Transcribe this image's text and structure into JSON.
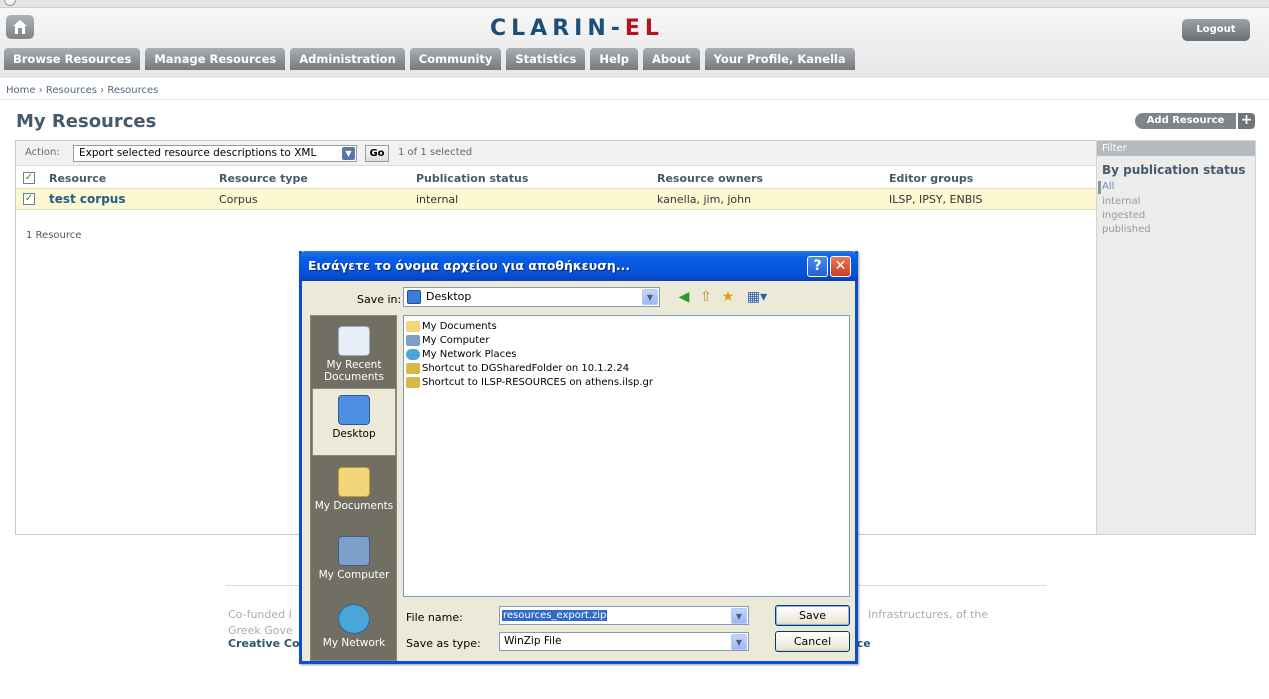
{
  "header": {
    "brand_main": "CLARIN-",
    "brand_accent": "EL",
    "logout": "Logout",
    "nav": [
      "Browse Resources",
      "Manage Resources",
      "Administration",
      "Community",
      "Statistics",
      "Help",
      "About",
      "Your Profile, Kanella"
    ]
  },
  "breadcrumb": "Home › Resources › Resources",
  "page_title": "My Resources",
  "add_resource": "Add Resource",
  "action": {
    "label": "Action:",
    "selected_option": "Export selected resource descriptions to XML",
    "go": "Go",
    "selection_count": "1 of 1 selected"
  },
  "table": {
    "headers": [
      "Resource",
      "Resource type",
      "Publication status",
      "Resource owners",
      "Editor groups"
    ],
    "rows": [
      {
        "resource": "test corpus",
        "type": "Corpus",
        "status": "internal",
        "owners": "kanella, jim, john",
        "groups": "ILSP, IPSY, ENBIS"
      }
    ],
    "count": "1 Resource"
  },
  "filter": {
    "title": "Filter",
    "heading": "By publication status",
    "options": [
      "All",
      "internal",
      "ingested",
      "published"
    ]
  },
  "footer": {
    "line1_left": "Co-funded I",
    "line1_right": "Infrastructures, of the",
    "line2_left": "Greek Gove",
    "line3_left": "Creative Co",
    "line3_right": "ice"
  },
  "dialog": {
    "title": "Εισάγετε το όνομα αρχείου για αποθήκευση...",
    "save_in_label": "Save in:",
    "save_in_value": "Desktop",
    "places": [
      "My Recent Documents",
      "Desktop",
      "My Documents",
      "My Computer",
      "My Network"
    ],
    "files": [
      "My Documents",
      "My Computer",
      "My Network Places",
      "Shortcut to DGSharedFolder on 10.1.2.24",
      "Shortcut to ILSP-RESOURCES on athens.ilsp.gr"
    ],
    "file_name_label": "File name:",
    "file_name_value": "resources_export.zip",
    "save_as_label": "Save as type:",
    "save_as_value": "WinZip File",
    "save": "Save",
    "cancel": "Cancel"
  }
}
